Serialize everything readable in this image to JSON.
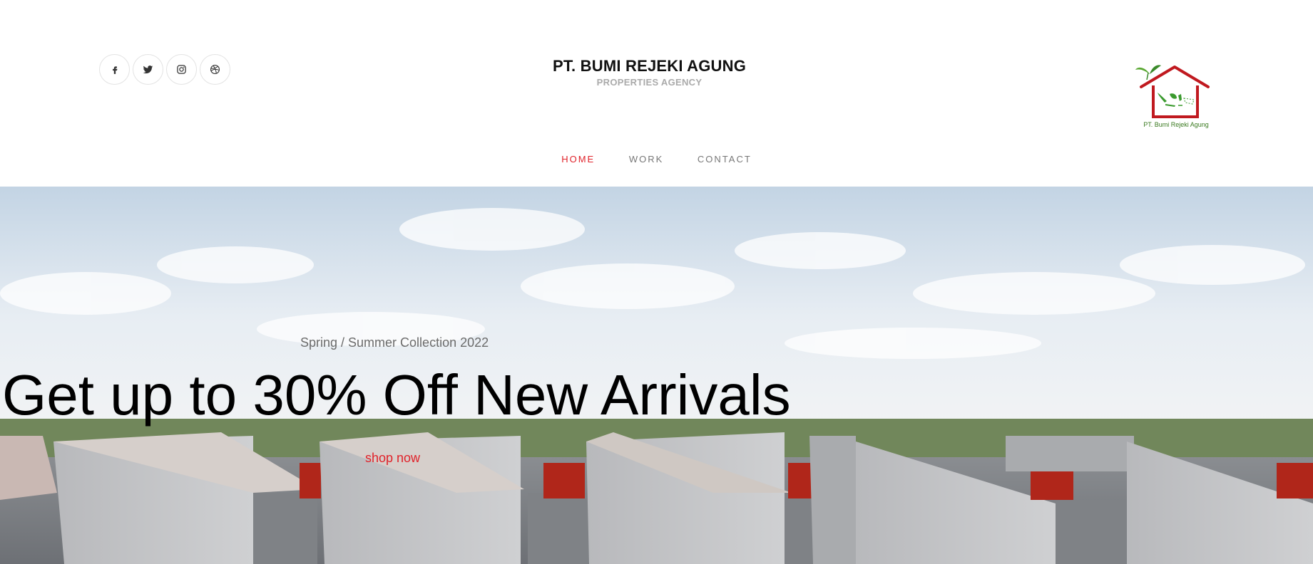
{
  "header": {
    "social": [
      {
        "name": "facebook-icon"
      },
      {
        "name": "twitter-icon"
      },
      {
        "name": "instagram-icon"
      },
      {
        "name": "dribbble-icon"
      }
    ],
    "brand_title": "PT. BUMI REJEKI AGUNG",
    "brand_subtitle": "PROPERTIES AGENCY",
    "logo_caption": "PT. Bumi Rejeki Agung"
  },
  "nav": {
    "items": [
      {
        "label": "HOME",
        "active": true
      },
      {
        "label": "WORK",
        "active": false
      },
      {
        "label": "CONTACT",
        "active": false
      }
    ]
  },
  "hero": {
    "subtitle": "Spring / Summer Collection 2022",
    "title": "Get up to 30% Off New Arrivals",
    "cta_label": "shop now"
  },
  "colors": {
    "accent": "#e0222a",
    "logo_red": "#c0191f",
    "logo_green": "#3a9a2e"
  }
}
